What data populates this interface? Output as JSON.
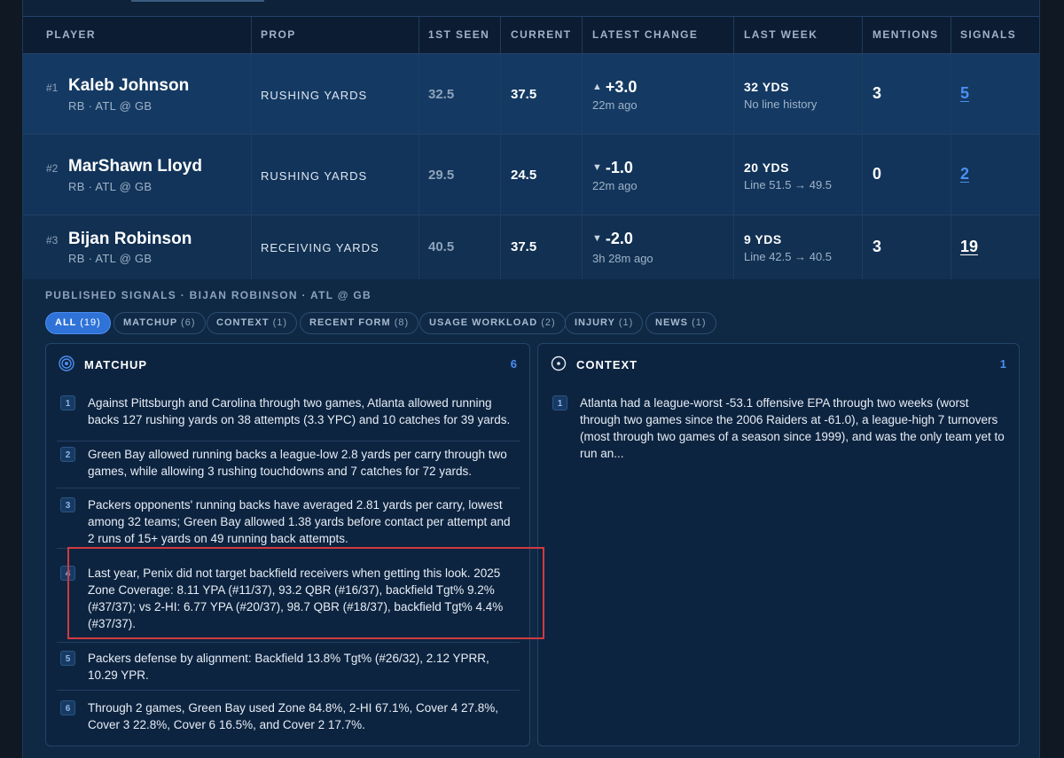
{
  "table": {
    "headers": {
      "player": "PLAYER",
      "prop": "PROP",
      "first_seen": "1ST SEEN",
      "current": "CURRENT",
      "latest_change": "LATEST CHANGE",
      "last_week": "LAST WEEK",
      "mentions": "MENTIONS",
      "signals": "SIGNALS"
    },
    "rows": [
      {
        "rank": "#1",
        "name": "Kaleb Johnson",
        "meta": "RB · ATL @ GB",
        "prop": "RUSHING YARDS",
        "first_seen": "32.5",
        "current": "37.5",
        "change_arrow": "▲",
        "change": "+3.0",
        "ago": "22m ago",
        "last_week": "32 YDS",
        "last_week_sub": "No line history",
        "mentions": "3",
        "signals": "5"
      },
      {
        "rank": "#2",
        "name": "MarShawn Lloyd",
        "meta": "RB · ATL @ GB",
        "prop": "RUSHING YARDS",
        "first_seen": "29.5",
        "current": "24.5",
        "change_arrow": "▼",
        "change": "-1.0",
        "ago": "22m ago",
        "last_week": "20 YDS",
        "last_week_sub": "Line 51.5 → 49.5",
        "mentions": "0",
        "signals": "2"
      },
      {
        "rank": "#3",
        "name": "Bijan Robinson",
        "meta": "RB · ATL @ GB",
        "prop": "RECEIVING YARDS",
        "first_seen": "40.5",
        "current": "37.5",
        "change_arrow": "▼",
        "change": "-2.0",
        "ago": "3h 28m ago",
        "last_week": "9 YDS",
        "last_week_sub": "Line 42.5 → 40.5",
        "mentions": "3",
        "signals": "19"
      }
    ]
  },
  "published": {
    "title": "PUBLISHED SIGNALS · BIJAN ROBINSON · ATL @ GB",
    "chips": [
      {
        "label": "ALL",
        "count": "(19)"
      },
      {
        "label": "MATCHUP",
        "count": "(6)"
      },
      {
        "label": "CONTEXT",
        "count": "(1)"
      },
      {
        "label": "RECENT FORM",
        "count": "(8)"
      },
      {
        "label": "USAGE WORKLOAD",
        "count": "(2)"
      },
      {
        "label": "INJURY",
        "count": "(1)"
      },
      {
        "label": "NEWS",
        "count": "(1)"
      }
    ],
    "matchup": {
      "title": "MATCHUP",
      "count": "6",
      "items": [
        {
          "num": "1",
          "text": "Against Pittsburgh and Carolina through two games, Atlanta allowed running backs 127 rushing yards on 38 attempts (3.3 YPC) and 10 catches for 39 yards."
        },
        {
          "num": "2",
          "text": "Green Bay allowed running backs a league-low 2.8 yards per carry through two games, while allowing 3 rushing touchdowns and 7 catches for 72 yards."
        },
        {
          "num": "3",
          "text": "Packers opponents' running backs have averaged 2.81 yards per carry, lowest among 32 teams; Green Bay allowed 1.38 yards before contact per attempt and 2 runs of 15+ yards on 49 running back attempts."
        },
        {
          "num": "4",
          "text": "Last year, Penix did not target backfield receivers when getting this look. 2025 Zone Coverage: 8.11 YPA (#11/37), 93.2 QBR (#16/37), backfield Tgt% 9.2% (#37/37); vs 2-HI: 6.77 YPA (#20/37), 98.7 QBR (#18/37), backfield Tgt% 4.4% (#37/37)."
        },
        {
          "num": "5",
          "text": "Packers defense by alignment: Backfield 13.8% Tgt% (#26/32), 2.12 YPRR, 10.29 YPR."
        },
        {
          "num": "6",
          "text": "Through 2 games, Green Bay used Zone 84.8%, 2-HI 67.1%, Cover 4 27.8%, Cover 3 22.8%, Cover 6 16.5%, and Cover 2 17.7%."
        }
      ]
    },
    "context": {
      "title": "CONTEXT",
      "count": "1",
      "items": [
        {
          "num": "1",
          "text": "Atlanta had a league-worst -53.1 offensive EPA through two weeks (worst through two games since the 2006 Raiders at -61.0), a league-high 7 turnovers (most through two games of a season since 1999), and was the only team yet to run an..."
        }
      ]
    }
  }
}
